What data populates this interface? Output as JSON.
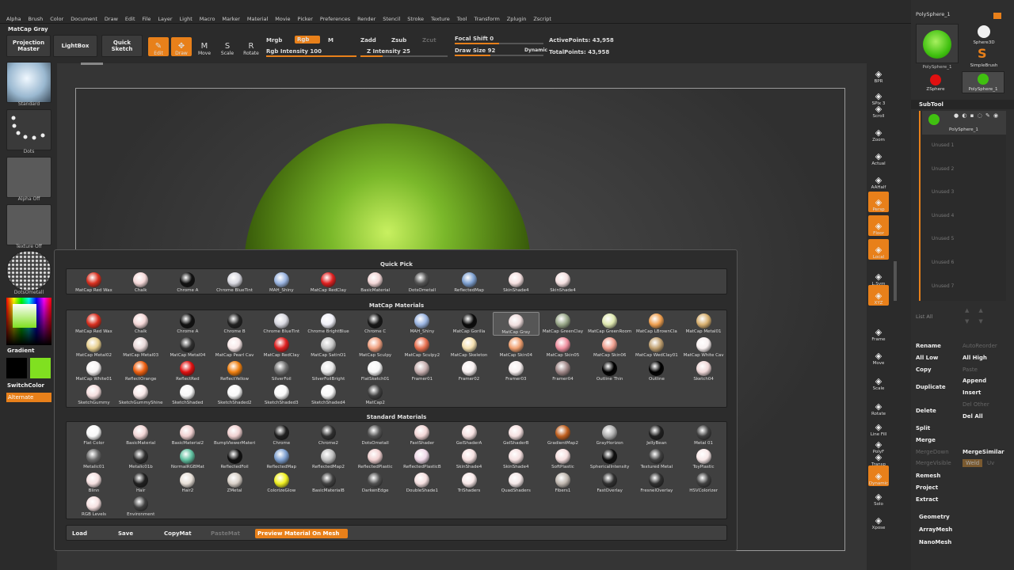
{
  "menu": [
    "Alpha",
    "Brush",
    "Color",
    "Document",
    "Draw",
    "Edit",
    "File",
    "Layer",
    "Light",
    "Macro",
    "Marker",
    "Material",
    "Movie",
    "Picker",
    "Preferences",
    "Render",
    "Stencil",
    "Stroke",
    "Texture",
    "Tool",
    "Transform",
    "Zplugin",
    "Zscript"
  ],
  "title": "MatCap Gray",
  "toolbar": {
    "projection_master": "Projection Master",
    "lightbox": "LightBox",
    "quick_sketch": "Quick Sketch",
    "edit": "Edit",
    "draw": "Draw",
    "move": "Move",
    "scale": "Scale",
    "rotate": "Rotate",
    "mrgb": "Mrgb",
    "rgb": "Rgb",
    "m": "M",
    "rgb_intensity": "Rgb Intensity 100",
    "zadd": "Zadd",
    "zsub": "Zsub",
    "zcut": "Zcut",
    "z_intensity": "Z Intensity 25",
    "focal_shift": "Focal Shift 0",
    "draw_size": "Draw Size 92",
    "dynamic": "Dynamic",
    "active_points": "ActivePoints: 43,958",
    "total_points": "TotalPoints: 43,958"
  },
  "left": {
    "standard": "Standard",
    "dots": "Dots",
    "alpha_off": "Alpha Off",
    "texture_off": "Texture Off",
    "dotsometall": "DotsOmetall",
    "gradient": "Gradient",
    "switchcolor": "SwitchColor",
    "alternate": "Alternate"
  },
  "popup": {
    "quick_pick_title": "Quick Pick",
    "matcap_title": "MatCap Materials",
    "standard_title": "Standard Materials",
    "quick_pick": [
      {
        "n": "MatCap Red Wax",
        "c": "#d83020"
      },
      {
        "n": "Chalk",
        "c": "#f5d8d8"
      },
      {
        "n": "Chrome A",
        "c": "#111"
      },
      {
        "n": "Chrome BlueTint",
        "c": "#d8d8e0"
      },
      {
        "n": "MAH_Shiny",
        "c": "#9ab4e0"
      },
      {
        "n": "MatCap RedClay",
        "c": "#e02020"
      },
      {
        "n": "BasicMaterial",
        "c": "#f2d6d6"
      },
      {
        "n": "DotsOmetall",
        "c": "#555"
      },
      {
        "n": "ReflectedMap",
        "c": "#7ea0d0"
      },
      {
        "n": "SkinShade4",
        "c": "#f5e0e0"
      },
      {
        "n": "SkinShade4",
        "c": "#f5e0e0"
      }
    ],
    "matcap": [
      {
        "n": "MatCap Red Wax",
        "c": "#d83020"
      },
      {
        "n": "Chalk",
        "c": "#f5d8d8"
      },
      {
        "n": "Chrome A",
        "c": "#111"
      },
      {
        "n": "Chrome B",
        "c": "#222"
      },
      {
        "n": "Chrome BlueTint",
        "c": "#d8d8e0"
      },
      {
        "n": "Chrome BrightBlue",
        "c": "#f0f0f8"
      },
      {
        "n": "Chrome C",
        "c": "#181818"
      },
      {
        "n": "MAH_Shiny",
        "c": "#9ab4e0"
      },
      {
        "n": "MatCap Gorilla",
        "c": "#0a0a0a"
      },
      {
        "n": "MatCap Gray",
        "c": "#f0dede"
      },
      {
        "n": "MatCap GreenClay",
        "c": "#9aa88a"
      },
      {
        "n": "MatCap GreenRoom",
        "c": "#dfe8b0"
      },
      {
        "n": "MatCap LBrownCla",
        "c": "#f0a050"
      },
      {
        "n": "MatCap Metal01",
        "c": "#d8b070"
      },
      {
        "n": "MatCap Metal02",
        "c": "#e8d090"
      },
      {
        "n": "MatCap Metal03",
        "c": "#e8d8d8"
      },
      {
        "n": "MatCap Metal04",
        "c": "#303030"
      },
      {
        "n": "MatCap Pearl Cav",
        "c": "#f8e8e8"
      },
      {
        "n": "MatCap RedClay",
        "c": "#e02020"
      },
      {
        "n": "MatCap SatinO1",
        "c": "#c8c8c8"
      },
      {
        "n": "MatCap Sculpy",
        "c": "#f0a080"
      },
      {
        "n": "MatCap Sculpy2",
        "c": "#e87050"
      },
      {
        "n": "MatCap Skeleton",
        "c": "#f5e0b0"
      },
      {
        "n": "MatCap Skin04",
        "c": "#f0a070"
      },
      {
        "n": "MatCap Skin05",
        "c": "#f090a0"
      },
      {
        "n": "MatCap Skin06",
        "c": "#f0a090"
      },
      {
        "n": "MatCap WedClay01",
        "c": "#c0a070"
      },
      {
        "n": "MatCap White Cav",
        "c": "#f8f0f0"
      },
      {
        "n": "MatCap White01",
        "c": "#f8f4f4"
      },
      {
        "n": "ReflectOrange",
        "c": "#f06010"
      },
      {
        "n": "ReflectRed",
        "c": "#e01010"
      },
      {
        "n": "ReflectYellow",
        "c": "#f08010"
      },
      {
        "n": "SilverFoil",
        "c": "#707070"
      },
      {
        "n": "SilverFoilBright",
        "c": "#e8e8e8"
      },
      {
        "n": "FlatSketch01",
        "c": "#f8f8f8"
      },
      {
        "n": "Framer01",
        "c": "#c8b0b0"
      },
      {
        "n": "Framer02",
        "c": "#f8f0f0"
      },
      {
        "n": "Framer03",
        "c": "#f8f0f0"
      },
      {
        "n": "Framer04",
        "c": "#a08888"
      },
      {
        "n": "Outline Thin",
        "c": "#000"
      },
      {
        "n": "Outline",
        "c": "#000"
      },
      {
        "n": "Sketch04",
        "c": "#f0d8d8"
      },
      {
        "n": "SketchGummy",
        "c": "#f5dede"
      },
      {
        "n": "SketchGummyShine",
        "c": "#f8e8e8"
      },
      {
        "n": "SketchShaded",
        "c": "#f8f8f8"
      },
      {
        "n": "SketchShaded2",
        "c": "#f8f8f8"
      },
      {
        "n": "SketchShaded3",
        "c": "#f8f8f8"
      },
      {
        "n": "SketchShaded4",
        "c": "#f8f8f8"
      },
      {
        "n": "MatCap2",
        "c": "#404040"
      }
    ],
    "standard": [
      {
        "n": "Flat Color",
        "c": "#f8f8f8"
      },
      {
        "n": "BasicMaterial",
        "c": "#f2d6d6"
      },
      {
        "n": "BasicMaterial2",
        "c": "#f0d0d0"
      },
      {
        "n": "BumpViewerMateri",
        "c": "#f0d0d0"
      },
      {
        "n": "Chrome",
        "c": "#202020"
      },
      {
        "n": "Chrome2",
        "c": "#303030"
      },
      {
        "n": "DotsOmetall",
        "c": "#555"
      },
      {
        "n": "FastShader",
        "c": "#f2d6d6"
      },
      {
        "n": "GelShaderA",
        "c": "#f5e0e0"
      },
      {
        "n": "GelShaderB",
        "c": "#f5e0e0"
      },
      {
        "n": "GradientMap2",
        "c": "#c06020"
      },
      {
        "n": "GrayHorizon",
        "c": "#b0b0b0"
      },
      {
        "n": "JellyBean",
        "c": "#202020"
      },
      {
        "n": "Metal 01",
        "c": "#404040"
      },
      {
        "n": "Metalic01",
        "c": "#686868"
      },
      {
        "n": "Metalic01b",
        "c": "#303030"
      },
      {
        "n": "NormalRGBMat",
        "c": "#60c0a0"
      },
      {
        "n": "ReflectedFoil",
        "c": "#101010"
      },
      {
        "n": "ReflectedMap",
        "c": "#7ea0d0"
      },
      {
        "n": "ReflectedMap2",
        "c": "#c0c0c0"
      },
      {
        "n": "ReflectedPlastic",
        "c": "#f0d0d0"
      },
      {
        "n": "ReflectedPlasticB",
        "c": "#f0d8e8"
      },
      {
        "n": "SkinShade4",
        "c": "#f5e0e0"
      },
      {
        "n": "SkinShade4",
        "c": "#f5e0e0"
      },
      {
        "n": "SoftPlastic",
        "c": "#f5dede"
      },
      {
        "n": "SphericalIntensity",
        "c": "#101010"
      },
      {
        "n": "Textured Metal",
        "c": "#404040"
      },
      {
        "n": "ToyPlastic",
        "c": "#f8e8e8"
      },
      {
        "n": "Blinn",
        "c": "#f5e0e0"
      },
      {
        "n": "Hair",
        "c": "#202020"
      },
      {
        "n": "Hair2",
        "c": "#e8e0d8"
      },
      {
        "n": "ZMetal",
        "c": "#d8d0c8"
      },
      {
        "n": "ColorizeGlow",
        "c": "#f0f020"
      },
      {
        "n": "BasicMaterialB",
        "c": "#404040"
      },
      {
        "n": "DarkenEdge",
        "c": "#505050"
      },
      {
        "n": "DoubleShade1",
        "c": "#f5e0e0"
      },
      {
        "n": "TriShaders",
        "c": "#f8e8e8"
      },
      {
        "n": "QuadShaders",
        "c": "#f5e8e8"
      },
      {
        "n": "Fibers1",
        "c": "#c0b8b0"
      },
      {
        "n": "FastOverlay",
        "c": "#303030"
      },
      {
        "n": "FresnelOverlay",
        "c": "#303030"
      },
      {
        "n": "HSVColorizer",
        "c": "#404040"
      },
      {
        "n": "RGB Levels",
        "c": "#f5e0e0"
      },
      {
        "n": "Environment",
        "c": "#404040"
      }
    ],
    "buttons": {
      "load": "Load",
      "save": "Save",
      "copymat": "CopyMat",
      "pastemat": "PasteMat",
      "preview": "Preview Material On Mesh"
    }
  },
  "rtools": [
    {
      "n": "BPR",
      "o": false
    },
    {
      "n": "SPix 3",
      "o": false
    },
    {
      "n": "Scroll",
      "o": false
    },
    {
      "n": "Zoom",
      "o": false
    },
    {
      "n": "Actual",
      "o": false
    },
    {
      "n": "AAHalf",
      "o": false
    },
    {
      "n": "Persp",
      "o": true
    },
    {
      "n": "Floor",
      "o": true
    },
    {
      "n": "Local",
      "o": true
    },
    {
      "n": "L.Sym",
      "o": false
    },
    {
      "n": "XYZ",
      "o": true
    },
    {
      "n": "Frame",
      "o": false
    },
    {
      "n": "Move",
      "o": false
    },
    {
      "n": "Scale",
      "o": false
    },
    {
      "n": "Rotate",
      "o": false
    },
    {
      "n": "Line Fill",
      "o": false
    },
    {
      "n": "PolyF",
      "o": false
    },
    {
      "n": "Transp",
      "o": false
    },
    {
      "n": "Dynamic",
      "o": true
    },
    {
      "n": "Solo",
      "o": false
    },
    {
      "n": "Xpose",
      "o": false
    }
  ],
  "right": {
    "top_name": "PolySphere_1",
    "sphere3d": "Sphere3D",
    "simplebrush": "SimpleBrush",
    "zsphere": "ZSphere",
    "polysphere": "PolySphere_1",
    "subtool": "SubTool",
    "polysphere_item": "PolySphere_1",
    "unused": [
      "Unused 1",
      "Unused 2",
      "Unused 3",
      "Unused 4",
      "Unused 5",
      "Unused 6",
      "Unused 7"
    ],
    "list_all": "List All",
    "rename": "Rename",
    "autoreorder": "AutoReorder",
    "all_low": "All Low",
    "all_high": "All High",
    "copy": "Copy",
    "paste": "Paste",
    "duplicate": "Duplicate",
    "append": "Append",
    "insert": "Insert",
    "delete": "Delete",
    "del_other": "Del Other",
    "del_all": "Del All",
    "split": "Split",
    "merge": "Merge",
    "mergedown": "MergeDown",
    "mergesimilar": "MergeSimilar",
    "mergevisible": "MergeVisible",
    "weld": "Weld",
    "uv": "Uv",
    "remesh": "Remesh",
    "project": "Project",
    "extract": "Extract",
    "geometry": "Geometry",
    "arraymesh": "ArrayMesh",
    "nanomesh": "NanoMesh"
  },
  "colors": {
    "accent": "#e8801a",
    "sphere": "#7ab82a",
    "primary_color": "#80e020"
  }
}
